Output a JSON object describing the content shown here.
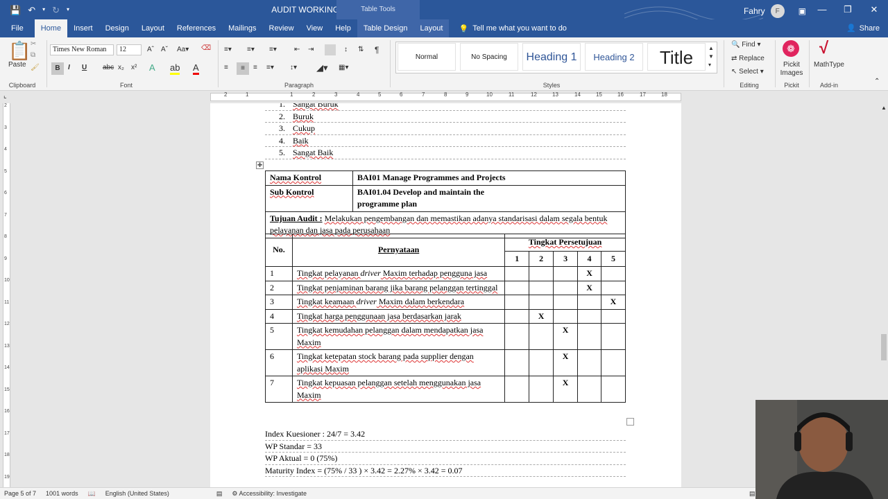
{
  "titlebar": {
    "doc_title": "AUDIT WORKING PAPER.docx  -  Word",
    "context_band": "Table Tools",
    "user_name": "Fahry",
    "user_initial": "F"
  },
  "tabs": [
    "File",
    "Home",
    "Insert",
    "Design",
    "Layout",
    "References",
    "Mailings",
    "Review",
    "View",
    "Help",
    "Table Design",
    "Layout"
  ],
  "tell_me": "Tell me what you want to do",
  "share_label": "Share",
  "ribbon": {
    "paste_label": "Paste",
    "clipboard_label": "Clipboard",
    "font_name": "Times New Roman",
    "font_size": "12",
    "font_label": "Font",
    "paragraph_label": "Paragraph",
    "styles_label": "Styles",
    "styles": [
      "Normal",
      "No Spacing",
      "Heading 1",
      "Heading 2",
      "Title"
    ],
    "editing": {
      "find": "Find",
      "replace": "Replace",
      "select": "Select",
      "label": "Editing"
    },
    "pickit": {
      "name": "Pickit Images",
      "group": "Pickit"
    },
    "mathtype": {
      "name": "MathType",
      "group": "Add-in"
    }
  },
  "ruler_numbers": [
    "2",
    "1",
    "1",
    "2",
    "3",
    "4",
    "5",
    "6",
    "7",
    "8",
    "9",
    "10",
    "11",
    "12",
    "13",
    "14",
    "15",
    "16",
    "17",
    "18"
  ],
  "vruler_numbers": [
    "2",
    "3",
    "4",
    "5",
    "6",
    "7",
    "8",
    "9",
    "10",
    "11",
    "12",
    "13",
    "14",
    "15",
    "16",
    "17",
    "18",
    "19"
  ],
  "scale_list": [
    {
      "n": "1.",
      "text": "Sangat Buruk"
    },
    {
      "n": "2.",
      "text": "Buruk"
    },
    {
      "n": "3.",
      "text": "Cukup"
    },
    {
      "n": "4.",
      "text": "Baik"
    },
    {
      "n": "5.",
      "text": "Sangat Baik"
    }
  ],
  "control_table": {
    "nama_label": "Nama Kontrol",
    "nama_value": "BAI01 Manage Programmes and Projects",
    "sub_label": "Sub Kontrol",
    "sub_value": "BAI01.04 Develop and maintain the programme plan",
    "tujuan_label": "Tujuan Audit :",
    "tujuan_text": "Melakukan pengembangan dan memastikan adanya standarisasi dalam segala bentuk pelayanan dan jasa pada perusahaan",
    "col_no": "No.",
    "col_pernyataan": "Pernyataan",
    "col_tingkat": "Tingkat Persetujuan",
    "scale_headers": [
      "1",
      "2",
      "3",
      "4",
      "5"
    ],
    "rows": [
      {
        "no": "1",
        "pre": "Tingkat pelayanan ",
        "em": "driver",
        "post": " Maxim terhadap pengguna jasa",
        "mark": 4
      },
      {
        "no": "2",
        "pre": "Tingkat penjaminan barang jika barang pelanggan tertinggal",
        "em": "",
        "post": "",
        "mark": 4
      },
      {
        "no": "3",
        "pre": "Tingkat keamaan ",
        "em": "driver",
        "post": " Maxim dalam berkendara",
        "mark": 5
      },
      {
        "no": "4",
        "pre": "Tingkat harga penggunaan jasa berdasarkan jarak",
        "em": "",
        "post": "",
        "mark": 2
      },
      {
        "no": "5",
        "pre": "Tingkat kemudahan pelanggan dalam mendapatkan jasa Maxim",
        "em": "",
        "post": "",
        "mark": 3
      },
      {
        "no": "6",
        "pre": "Tingkat ketepatan stock barang pada supplier dengan aplikasi Maxim",
        "em": "",
        "post": "",
        "mark": 3
      },
      {
        "no": "7",
        "pre": "Tingkat kepuasan pelanggan setelah menggunakan jasa Maxim",
        "em": "",
        "post": "",
        "mark": 3
      }
    ],
    "mark_symbol": "X"
  },
  "summary": [
    "Index Kuesioner : 24/7 = 3.42",
    "WP Standar = 33",
    "WP Aktual = 0 (75%)",
    "Maturity Index = (75% / 33 ) × 3.42 = 2.27% × 3.42 = 0.07"
  ],
  "statusbar": {
    "page": "Page 5 of 7",
    "words": "1001 words",
    "language": "English (United States)",
    "accessibility": "Accessibility: Investigate"
  }
}
